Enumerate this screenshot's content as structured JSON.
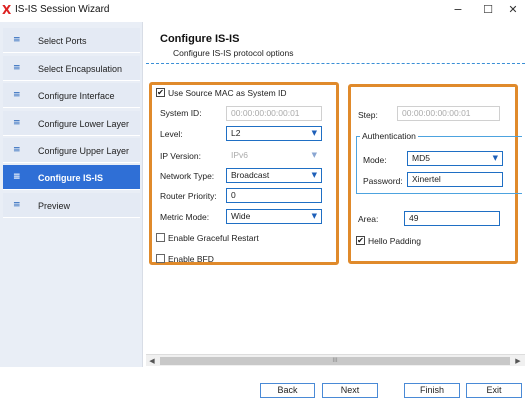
{
  "window": {
    "logo_text": "X",
    "title": "IS-IS Session Wizard",
    "minimize_glyph": "−",
    "maximize_glyph": "☐",
    "close_glyph": "✕"
  },
  "sidebar": {
    "items": [
      {
        "label": "Select Ports",
        "icon": "list-icon",
        "glyph": "≡",
        "active": false
      },
      {
        "label": "Select Encapsulation",
        "icon": "list-icon",
        "glyph": "≡",
        "active": false
      },
      {
        "label": "Configure Interface",
        "icon": "list-icon",
        "glyph": "≡",
        "active": false
      },
      {
        "label": "Configure Lower Layer",
        "icon": "list-icon",
        "glyph": "≡",
        "active": false
      },
      {
        "label": "Configure Upper Layer",
        "icon": "list-icon",
        "glyph": "≡",
        "active": false
      },
      {
        "label": "Configure IS-IS",
        "icon": "list-icon",
        "glyph": "≡",
        "active": true
      },
      {
        "label": "Preview",
        "icon": "list-icon",
        "glyph": "≡",
        "active": false
      }
    ]
  },
  "header": {
    "title": "Configure IS-IS",
    "subtitle": "Configure IS-IS protocol options"
  },
  "left_panel": {
    "use_source_mac": {
      "label": "Use Source MAC as System ID",
      "checked": true
    },
    "system_id": {
      "label": "System ID:",
      "value": "00:00:00:00:00:01"
    },
    "level": {
      "label": "Level:",
      "value": "L2"
    },
    "ip_version": {
      "label": "IP Version:",
      "value": "IPv6"
    },
    "network_type": {
      "label": "Network Type:",
      "value": "Broadcast"
    },
    "router_priority": {
      "label": "Router Priority:",
      "value": "0"
    },
    "metric_mode": {
      "label": "Metric Mode:",
      "value": "Wide"
    },
    "graceful_restart": {
      "label": "Enable Graceful Restart",
      "checked": false
    },
    "bfd": {
      "label": "Enable BFD",
      "checked": false
    }
  },
  "right_panel": {
    "step": {
      "label": "Step:",
      "value": "00:00:00:00:00:01"
    },
    "authentication": {
      "title": "Authentication",
      "mode": {
        "label": "Mode:",
        "value": "MD5"
      },
      "password": {
        "label": "Password:",
        "value": "Xinertel"
      }
    },
    "area": {
      "label": "Area:",
      "value": "49"
    },
    "hello_padding": {
      "label": "Hello Padding",
      "checked": true
    }
  },
  "scrollbar": {
    "left_arrow": "◀",
    "right_arrow": "▶",
    "grip": "III"
  },
  "footer": {
    "back_label": "Back",
    "next_label": "Next",
    "finish_label": "Finish",
    "exit_label": "Exit"
  },
  "glyphs": {
    "dropdown": "▼",
    "checkmark": "✔"
  },
  "colors": {
    "accent": "#2f6fd6",
    "highlight_border": "#e08a2b",
    "field_border": "#1f6fc4"
  }
}
